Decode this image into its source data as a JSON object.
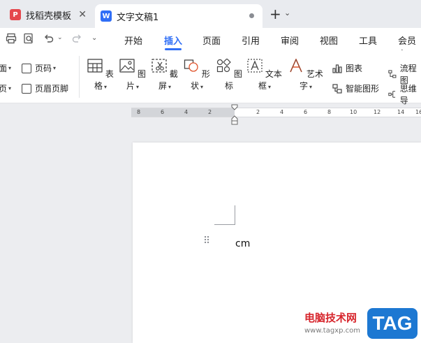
{
  "tabs": [
    {
      "label": "找稻壳模板",
      "logo": "P"
    },
    {
      "label": "文字文稿1",
      "logo": "W"
    }
  ],
  "tabbar": {
    "new_tab": "+",
    "dropdown": "⌄",
    "close": "✕"
  },
  "menu": {
    "items": [
      "开始",
      "插入",
      "页面",
      "引用",
      "审阅",
      "视图",
      "工具",
      "会员专"
    ],
    "active": "插入"
  },
  "ribbon": {
    "left_col1": [
      "面",
      "页"
    ],
    "left_col2": [
      "页码",
      "页眉页脚"
    ],
    "big": [
      "表格",
      "图片",
      "截屏",
      "形状",
      "图标",
      "文本框",
      "艺术字"
    ],
    "right_col1": [
      "图表",
      "智能图形"
    ],
    "right_col2": [
      "流程图",
      "思维导"
    ]
  },
  "ruler": {
    "ticks": [
      "8",
      "6",
      "4",
      "2",
      "2",
      "4",
      "6",
      "8",
      "10",
      "12",
      "14",
      "16"
    ]
  },
  "document": {
    "text": "cm"
  },
  "watermark": {
    "site": "电脑技术网",
    "url": "www.tagxp.com",
    "tag": "TAG"
  },
  "colors": {
    "accent": "#2f6ef6",
    "watermark_red": "#d7262d",
    "tag_blue": "#1d78d2"
  }
}
